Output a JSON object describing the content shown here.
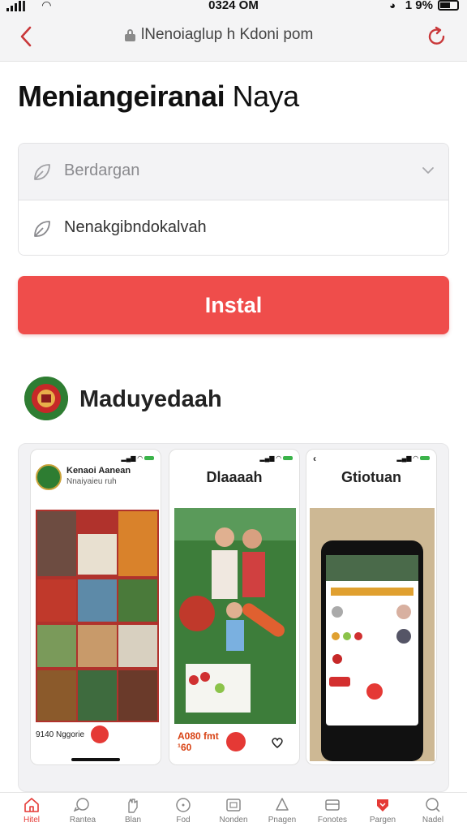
{
  "status_bar": {
    "time": "0324 OM",
    "battery": "1 9%"
  },
  "browser": {
    "url": "lNenoiaglup h Kdoni pom"
  },
  "page": {
    "title_bold": "Meniangeiranai",
    "title_light": "Naya"
  },
  "form": {
    "select_placeholder": "Berdargan",
    "input_value": "Nenakgibndokalvah"
  },
  "install_button": "Instal",
  "app": {
    "name": "Maduyedaah"
  },
  "screenshots": [
    {
      "header_line1": "Kenaoi Aanean",
      "header_line2": "Nnaiyaieu ruh",
      "footer_text": "9140 Nggorie"
    },
    {
      "title": "Dlaaaah",
      "price_line1": "A080 fmt",
      "price_line2": "¹60"
    },
    {
      "title": "Gtiotuan"
    }
  ],
  "bottom_nav": [
    {
      "label": "Hitel",
      "icon": "home-icon",
      "active": true
    },
    {
      "label": "Rantea",
      "icon": "chat-icon",
      "active": false
    },
    {
      "label": "Blan",
      "icon": "hand-icon",
      "active": false
    },
    {
      "label": "Fod",
      "icon": "compass-icon",
      "active": false
    },
    {
      "label": "Nonden",
      "icon": "gallery-icon",
      "active": false
    },
    {
      "label": "Pnagen",
      "icon": "drop-icon",
      "active": false
    },
    {
      "label": "Fonotes",
      "icon": "card-icon",
      "active": false
    },
    {
      "label": "Pargen",
      "icon": "heart-icon",
      "active": false
    },
    {
      "label": "Nadel",
      "icon": "search-icon",
      "active": false
    }
  ],
  "colors": {
    "accent": "#ef4d4b",
    "brand_green": "#2e7d32"
  }
}
